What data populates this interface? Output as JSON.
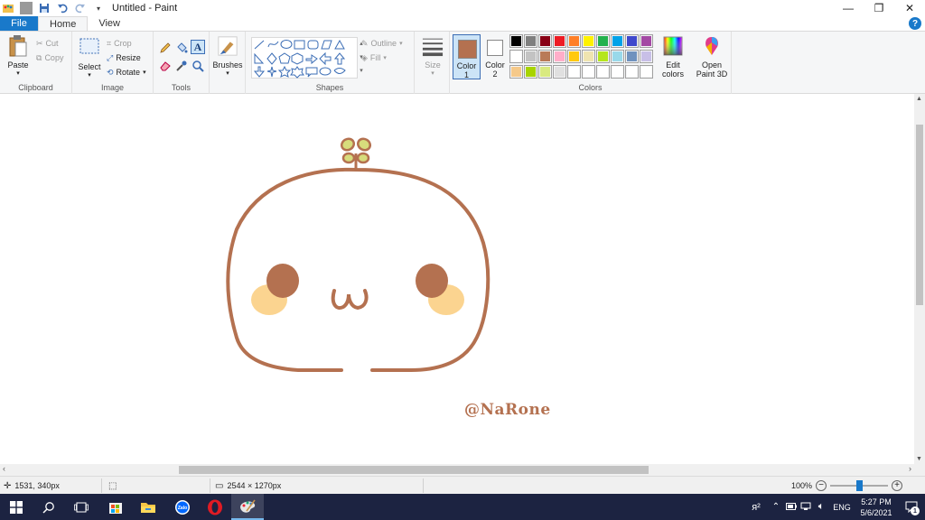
{
  "titlebar": {
    "title": "Untitled - Paint",
    "quick_access": [
      "paint-app-icon",
      "save-icon",
      "undo-icon",
      "redo-icon",
      "customize-icon"
    ]
  },
  "tabs": [
    {
      "label": "File"
    },
    {
      "label": "Home"
    },
    {
      "label": "View"
    }
  ],
  "ribbon": {
    "clipboard": {
      "label": "Clipboard",
      "paste": "Paste",
      "cut": "Cut",
      "copy": "Copy"
    },
    "image": {
      "label": "Image",
      "select": "Select",
      "crop": "Crop",
      "resize": "Resize",
      "rotate": "Rotate"
    },
    "tools": {
      "label": "Tools"
    },
    "brushes": {
      "label": "Brushes"
    },
    "shapes": {
      "label": "Shapes",
      "outline": "Outline",
      "fill": "Fill"
    },
    "size": {
      "label": "Size"
    },
    "colors": {
      "label": "Colors",
      "color1": "Color 1",
      "color1_line1": "Color",
      "color1_line2": "1",
      "color2_line1": "Color",
      "color2_line2": "2",
      "color1_value": "#b47150",
      "color2_value": "#ffffff",
      "edit_colors_line1": "Edit",
      "edit_colors_line2": "colors",
      "palette_row1": [
        "#000000",
        "#7f7f7f",
        "#880015",
        "#ed1c24",
        "#ff7f27",
        "#fff200",
        "#22b14c",
        "#00a2e8",
        "#3f48cc",
        "#a349a4"
      ],
      "palette_row2": [
        "#ffffff",
        "#c3c3c3",
        "#b97a57",
        "#ffaec9",
        "#ffc90e",
        "#efe4b0",
        "#b5e61d",
        "#99d9ea",
        "#7092be",
        "#c8bfe7"
      ],
      "palette_row3": [
        "#f5c98a",
        "#a8d400",
        "#d9ea80",
        "#e0e0e0",
        "#ffffff",
        "#ffffff",
        "#ffffff",
        "#ffffff",
        "#ffffff",
        "#ffffff"
      ]
    },
    "paint3d": {
      "line1": "Open",
      "line2": "Paint 3D"
    }
  },
  "drawing": {
    "outline_color": "#b47150",
    "cheek_color": "#fbd490",
    "sprout_color": "#d7dc7c",
    "signature": "@NaRone"
  },
  "statusbar": {
    "cursor_pos": "1531, 340px",
    "canvas_size": "2544 × 1270px",
    "zoom": "100%",
    "zoom_level": 0.5
  },
  "taskbar": {
    "time": "5:27 PM",
    "date": "5/6/2021",
    "language": "ENG",
    "notifications": "1"
  }
}
